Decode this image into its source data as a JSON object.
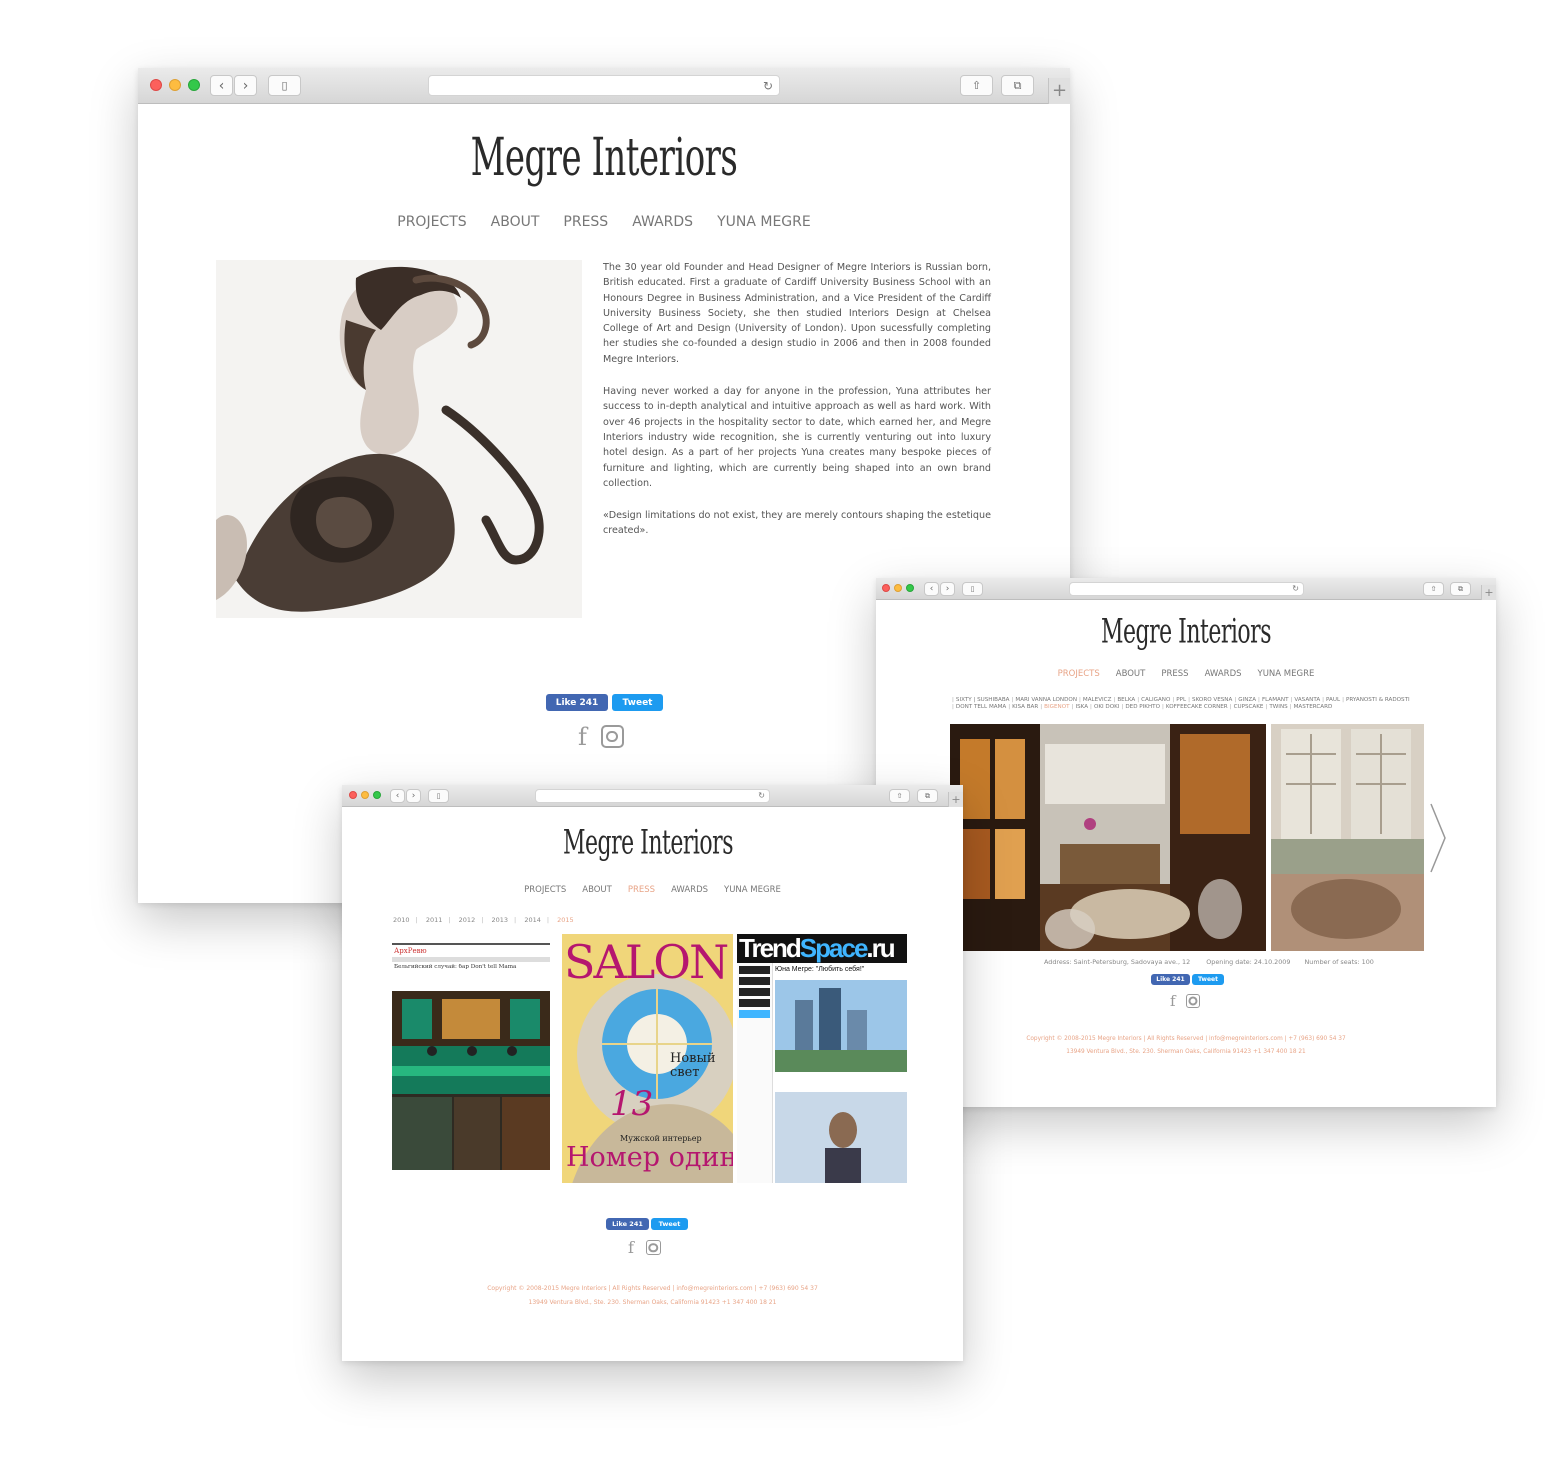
{
  "brand": {
    "logo_text": "Megre Interiors"
  },
  "nav": [
    "PROJECTS",
    "ABOUT",
    "PRESS",
    "AWARDS",
    "YUNA MEGRE"
  ],
  "about": {
    "paragraphs": [
      "The 30 year old Founder and Head Designer of Megre Interiors is Russian born, British educated. First a graduate of Cardiff University Business School with an Honours Degree in Business Administration, and a Vice President of the Cardiff University Business Society, she then studied Interiors Design at Chelsea College of Art and Design (University of London). Upon sucessfully completing her studies she co-founded a design studio in 2006 and then in 2008 founded Megre Interiors.",
      "Having never worked a day for anyone in the profession, Yuna attributes her success to in-depth analytical and intuitive approach as well as hard work. With over 46 projects in the hospitality sector to date, which earned her, and Megre Interiors industry wide recognition, she is currently venturing out into luxury hotel design. As a part of her projects Yuna creates many bespoke pieces of furniture and lighting, which are currently being shaped into an own brand collection.",
      "«Design limitations do not exist, they are merely contours shaping the estetique created»."
    ]
  },
  "social": {
    "like_label": "Like 241",
    "tweet_label": "Tweet"
  },
  "press": {
    "years": [
      "2010",
      "2011",
      "2012",
      "2013",
      "2014",
      "2015"
    ],
    "active_year": "2015",
    "magazines": {
      "salon": {
        "title": "SALON",
        "headline": "Номер один",
        "big_number": "13",
        "subtitle": "Мужской интерьер",
        "badge": "Новый свет"
      },
      "trendspace": {
        "title_a": "Trend",
        "title_b": "Space",
        "title_c": ".ru",
        "headline": "Юна Мегре: \"Любить себя!\""
      },
      "arch": {
        "masthead": "АрхРевю",
        "headline": "Бельгийский случай: бар Don't tell Mama"
      }
    }
  },
  "projects": {
    "list": [
      "SIXTY | SUSHIBABA",
      "MARI VANNA LONDON",
      "MALEVICZ",
      "BELKA",
      "CALIGANO",
      "PPL",
      "SKORO VESNA",
      "GINZA",
      "FLAMANT",
      "VASANTA",
      "PAUL",
      "PRYANOSTI & RADOSTI",
      "DONT TELL MAMA",
      "KISA BAR",
      "BIGENOT",
      "ISKA",
      "OKI DOKI",
      "DED PIKHTO",
      "KOFFEECAKE CORNER",
      "CUPSCAKE",
      "TWINS",
      "MASTERCARD"
    ],
    "active": "BIGENOT",
    "caption": {
      "address": "Address: Saint-Petersburg, Sadovaya ave., 12",
      "opening": "Opening date: 24.10.2009",
      "seats": "Number of seats: 100"
    }
  },
  "footer": {
    "line1": "Copyright © 2008-2015 Megre Interiors | All Rights Reserved | info@megreinteriors.com | +7 (963) 690 54 37",
    "line2": "13949 Ventura Blvd., Ste. 230. Sherman Oaks, California 91423 +1 347 400 18 21"
  },
  "colors": {
    "accent": "#e8a487",
    "fb": "#4267b2",
    "tw": "#1d9bf0",
    "nav_text": "#777777"
  },
  "icons": [
    "back-icon",
    "forward-icon",
    "sidebar-icon",
    "reload-icon",
    "share-icon",
    "tabs-icon",
    "plus-icon",
    "facebook-icon",
    "instagram-icon",
    "chevron-right-icon"
  ]
}
